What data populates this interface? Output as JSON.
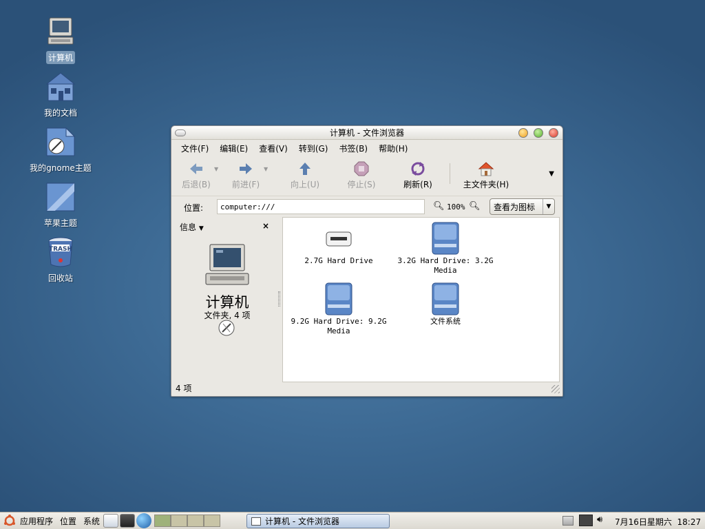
{
  "desktop": {
    "icons": [
      {
        "label": "计算机",
        "icon": "computer-icon",
        "selected": true
      },
      {
        "label": "我的文档",
        "icon": "home-folder-icon"
      },
      {
        "label": "我的gnome主题",
        "icon": "gnome-theme-icon"
      },
      {
        "label": "苹果主题",
        "icon": "apple-theme-icon"
      },
      {
        "label": "回收站",
        "icon": "trash-icon"
      }
    ]
  },
  "window": {
    "title": "计算机 - 文件浏览器",
    "menu": [
      "文件(F)",
      "编辑(E)",
      "查看(V)",
      "转到(G)",
      "书签(B)",
      "帮助(H)"
    ],
    "toolbar": {
      "back": "后退(B)",
      "forward": "前进(F)",
      "up": "向上(U)",
      "stop": "停止(S)",
      "reload": "刷新(R)",
      "home": "主文件夹(H)"
    },
    "location": {
      "label": "位置:",
      "value": "computer:///",
      "zoom": "100%",
      "view_as": "查看为图标"
    },
    "sidebar": {
      "mode": "信息",
      "title": "计算机",
      "subtitle": "文件夹, 4 项"
    },
    "files": [
      {
        "name": "2.7G Hard Drive",
        "icon": "removable-drive-icon"
      },
      {
        "name": "3.2G Hard Drive: 3.2G Media",
        "icon": "hard-drive-icon"
      },
      {
        "name": "9.2G Hard Drive: 9.2G Media",
        "icon": "hard-drive-icon"
      },
      {
        "name": "文件系统",
        "icon": "filesystem-icon"
      }
    ],
    "status": "4 项"
  },
  "panel": {
    "menus": [
      "应用程序",
      "位置",
      "系统"
    ],
    "task": "计算机 - 文件浏览器",
    "clock": "7月16日星期六  18:27"
  }
}
